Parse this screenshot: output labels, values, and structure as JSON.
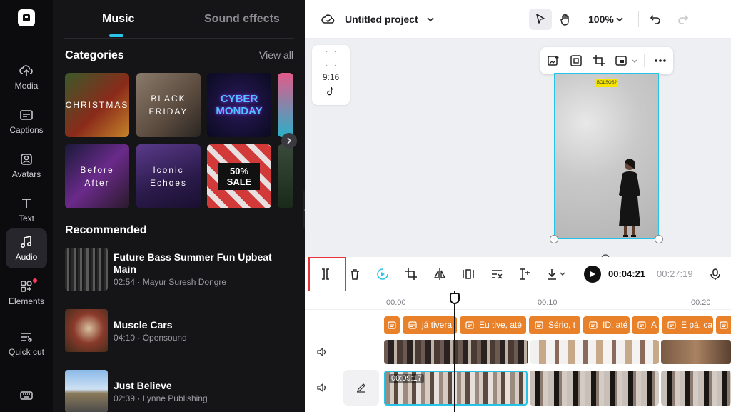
{
  "rail": {
    "items": [
      {
        "label": "Media",
        "icon": "cloud-upload-icon"
      },
      {
        "label": "Captions",
        "icon": "captions-icon"
      },
      {
        "label": "Avatars",
        "icon": "avatar-icon"
      },
      {
        "label": "Text",
        "icon": "text-icon"
      },
      {
        "label": "Audio",
        "icon": "music-note-icon",
        "active": true
      },
      {
        "label": "Elements",
        "icon": "elements-icon",
        "notification": true
      },
      {
        "label": "Quick cut",
        "icon": "quick-cut-icon"
      }
    ]
  },
  "panel": {
    "tabs": [
      "Music",
      "Sound effects"
    ],
    "active_tab": "Music",
    "categories_title": "Categories",
    "view_all": "View all",
    "categories": [
      {
        "label": "CHRISTMAS"
      },
      {
        "label": "BLACK FRIDAY"
      },
      {
        "label": "CYBER MONDAY"
      },
      {
        "label": "Before After"
      },
      {
        "label": "Iconic Echoes"
      },
      {
        "label": "50% SALE"
      }
    ],
    "recommended_title": "Recommended",
    "tracks": [
      {
        "title": "Future Bass Summer Fun Upbeat Main",
        "meta": "02:54 · Mayur Suresh Dongre"
      },
      {
        "title": "Muscle Cars",
        "meta": "04:10 · Opensound"
      },
      {
        "title": "Just Believe",
        "meta": "02:39 · Lynne Publishing"
      }
    ]
  },
  "topbar": {
    "project_name": "Untitled project",
    "zoom": "100%"
  },
  "canvas": {
    "ratio": "9:16",
    "badge": "BOLSOS?"
  },
  "timeline": {
    "current_time": "00:04:21",
    "total_time": "00:27:19",
    "ticks": [
      "00:00",
      "00:10",
      "00:20"
    ],
    "subtitles": [
      "",
      "já tivera",
      "Eu tive, até",
      "Sério, t",
      "ID, até",
      "A",
      "E pá, ca"
    ],
    "clip_duration": "00:09:17"
  },
  "colors": {
    "accent": "#29c4e8",
    "caption": "#e8812a",
    "highlight": "#e8313a"
  }
}
